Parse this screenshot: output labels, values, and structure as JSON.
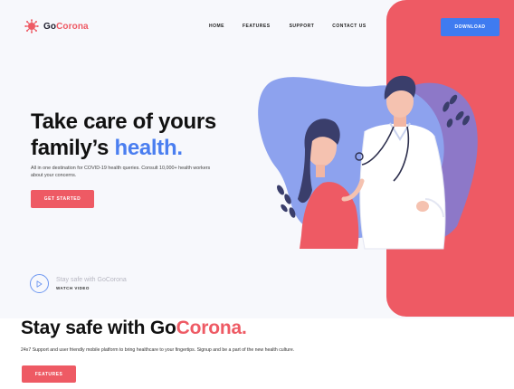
{
  "brand": {
    "name_part1": "Go",
    "name_part2": "Corona"
  },
  "nav": {
    "items": [
      "HOME",
      "FEATURES",
      "SUPPORT",
      "CONTACT US"
    ]
  },
  "header": {
    "download_label": "DOWNLOAD"
  },
  "hero": {
    "title_line1": "Take care of yours",
    "title_line2_prefix": "family’s ",
    "title_line2_accent": "health.",
    "subtitle": "All in one destination for COVID-19 health queries. Consult 10,000+ health workers about your concerns.",
    "cta_label": "GET STARTED"
  },
  "video": {
    "title": "Stay safe with GoCorona",
    "subtitle": "WATCH VIDEO",
    "icon": "play-icon"
  },
  "section2": {
    "title_prefix": "Stay safe with Go",
    "title_accent": "Corona.",
    "subtitle": "24x7 Support and user friendly mobile platform to bring healthcare to your fingertips. Signup and be a part of the new health culture.",
    "cta_label": "FEATURES"
  },
  "colors": {
    "accent_red": "#ee5a64",
    "accent_blue": "#4a7ef0",
    "blob_blue": "#8da2ee",
    "blob_purple": "#8d78c8",
    "dark_navy": "#3a3e6b"
  }
}
